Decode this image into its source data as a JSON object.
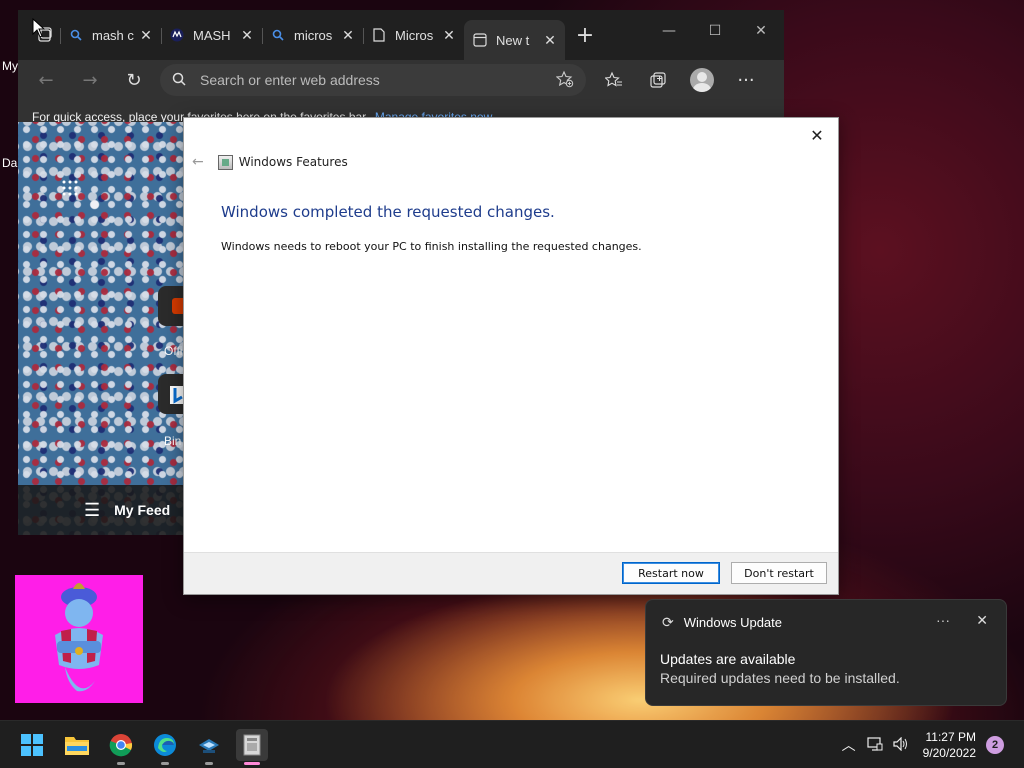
{
  "browser": {
    "tabs": [
      {
        "title": "mash c",
        "icon": "search-icon"
      },
      {
        "title": "MASH",
        "icon": "mash-logo-icon"
      },
      {
        "title": "micros",
        "icon": "search-icon"
      },
      {
        "title": "Micros",
        "icon": "document-icon"
      },
      {
        "title": "New t",
        "icon": "newtab-icon"
      }
    ],
    "address_placeholder": "Search or enter web address",
    "favbar_text": "For quick access, place your favorites here on the favorites bar.",
    "favbar_link": "Manage favorites now",
    "newtab": {
      "tile1_label": "Offi",
      "tile2_label": "Bin",
      "feed_label": "My Feed"
    }
  },
  "desktop": {
    "label_my": "My",
    "label_da": "Da"
  },
  "dialog": {
    "title": "Windows Features",
    "heading": "Windows completed the requested changes.",
    "body": "Windows needs to reboot your PC to finish installing the requested changes.",
    "restart_label": "Restart now",
    "dont_restart_label": "Don't restart"
  },
  "toast": {
    "app": "Windows Update",
    "title": "Updates are available",
    "subtitle": "Required updates need to be installed."
  },
  "taskbar": {
    "time": "11:27 PM",
    "date": "9/20/2022",
    "notification_count": "2"
  },
  "colors": {
    "dialog_heading": "#1e3c8c",
    "link": "#6cb0ff",
    "genie_bg": "#ff1ee8"
  }
}
